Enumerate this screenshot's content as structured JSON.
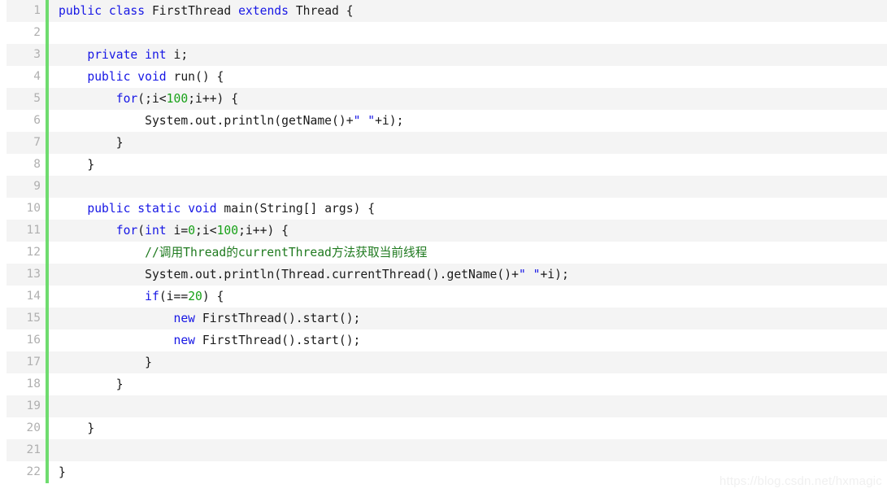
{
  "editor": {
    "language": "java",
    "colors": {
      "background": "#ffffff",
      "stripe": "#f4f4f4",
      "gutter_bar": "#6fdc6f",
      "line_number": "#b0b0b0",
      "keyword": "#1717e5",
      "string": "#1717e5",
      "number": "#17a117",
      "comment": "#1f7a1f",
      "plain_text": "#1a1a1a",
      "watermark": "#f0f0f0"
    },
    "line_count": 22,
    "first_line_number": 1,
    "lines": [
      {
        "number": "1",
        "stripe": true,
        "tokens": [
          {
            "t": "public",
            "c": "kw"
          },
          {
            "t": " ",
            "c": "plain"
          },
          {
            "t": "class",
            "c": "kw"
          },
          {
            "t": " FirstThread ",
            "c": "plain"
          },
          {
            "t": "extends",
            "c": "kw"
          },
          {
            "t": " Thread {",
            "c": "plain"
          }
        ]
      },
      {
        "number": "2",
        "stripe": false,
        "tokens": []
      },
      {
        "number": "3",
        "stripe": true,
        "tokens": [
          {
            "t": "    ",
            "c": "plain"
          },
          {
            "t": "private",
            "c": "kw"
          },
          {
            "t": " ",
            "c": "plain"
          },
          {
            "t": "int",
            "c": "kw"
          },
          {
            "t": " i;",
            "c": "plain"
          }
        ]
      },
      {
        "number": "4",
        "stripe": false,
        "tokens": [
          {
            "t": "    ",
            "c": "plain"
          },
          {
            "t": "public",
            "c": "kw"
          },
          {
            "t": " ",
            "c": "plain"
          },
          {
            "t": "void",
            "c": "kw"
          },
          {
            "t": " run() {",
            "c": "plain"
          }
        ]
      },
      {
        "number": "5",
        "stripe": true,
        "tokens": [
          {
            "t": "        ",
            "c": "plain"
          },
          {
            "t": "for",
            "c": "kw"
          },
          {
            "t": "(;i<",
            "c": "plain"
          },
          {
            "t": "100",
            "c": "num"
          },
          {
            "t": ";i++) {",
            "c": "plain"
          }
        ]
      },
      {
        "number": "6",
        "stripe": false,
        "tokens": [
          {
            "t": "            System.out.println(getName()+",
            "c": "plain"
          },
          {
            "t": "\" \"",
            "c": "str"
          },
          {
            "t": "+i);",
            "c": "plain"
          }
        ]
      },
      {
        "number": "7",
        "stripe": true,
        "tokens": [
          {
            "t": "        }",
            "c": "plain"
          }
        ]
      },
      {
        "number": "8",
        "stripe": false,
        "tokens": [
          {
            "t": "    }",
            "c": "plain"
          }
        ]
      },
      {
        "number": "9",
        "stripe": true,
        "tokens": []
      },
      {
        "number": "10",
        "stripe": false,
        "tokens": [
          {
            "t": "    ",
            "c": "plain"
          },
          {
            "t": "public",
            "c": "kw"
          },
          {
            "t": " ",
            "c": "plain"
          },
          {
            "t": "static",
            "c": "kw"
          },
          {
            "t": " ",
            "c": "plain"
          },
          {
            "t": "void",
            "c": "kw"
          },
          {
            "t": " main(String[] args) {",
            "c": "plain"
          }
        ]
      },
      {
        "number": "11",
        "stripe": true,
        "tokens": [
          {
            "t": "        ",
            "c": "plain"
          },
          {
            "t": "for",
            "c": "kw"
          },
          {
            "t": "(",
            "c": "plain"
          },
          {
            "t": "int",
            "c": "kw"
          },
          {
            "t": " i=",
            "c": "plain"
          },
          {
            "t": "0",
            "c": "num"
          },
          {
            "t": ";i<",
            "c": "plain"
          },
          {
            "t": "100",
            "c": "num"
          },
          {
            "t": ";i++) {",
            "c": "plain"
          }
        ]
      },
      {
        "number": "12",
        "stripe": false,
        "tokens": [
          {
            "t": "            ",
            "c": "plain"
          },
          {
            "t": "//调用Thread的currentThread方法获取当前线程",
            "c": "cmt"
          }
        ]
      },
      {
        "number": "13",
        "stripe": true,
        "tokens": [
          {
            "t": "            System.out.println(Thread.currentThread().getName()+",
            "c": "plain"
          },
          {
            "t": "\" \"",
            "c": "str"
          },
          {
            "t": "+i);",
            "c": "plain"
          }
        ]
      },
      {
        "number": "14",
        "stripe": false,
        "tokens": [
          {
            "t": "            ",
            "c": "plain"
          },
          {
            "t": "if",
            "c": "kw"
          },
          {
            "t": "(i==",
            "c": "plain"
          },
          {
            "t": "20",
            "c": "num"
          },
          {
            "t": ") {",
            "c": "plain"
          }
        ]
      },
      {
        "number": "15",
        "stripe": true,
        "tokens": [
          {
            "t": "                ",
            "c": "plain"
          },
          {
            "t": "new",
            "c": "kw"
          },
          {
            "t": " FirstThread().start();",
            "c": "plain"
          }
        ]
      },
      {
        "number": "16",
        "stripe": false,
        "tokens": [
          {
            "t": "                ",
            "c": "plain"
          },
          {
            "t": "new",
            "c": "kw"
          },
          {
            "t": " FirstThread().start();",
            "c": "plain"
          }
        ]
      },
      {
        "number": "17",
        "stripe": true,
        "tokens": [
          {
            "t": "            }",
            "c": "plain"
          }
        ]
      },
      {
        "number": "18",
        "stripe": false,
        "tokens": [
          {
            "t": "        }",
            "c": "plain"
          }
        ]
      },
      {
        "number": "19",
        "stripe": true,
        "tokens": []
      },
      {
        "number": "20",
        "stripe": false,
        "tokens": [
          {
            "t": "    }",
            "c": "plain"
          }
        ]
      },
      {
        "number": "21",
        "stripe": true,
        "tokens": []
      },
      {
        "number": "22",
        "stripe": false,
        "tokens": [
          {
            "t": "}",
            "c": "plain"
          }
        ]
      }
    ]
  },
  "watermark": {
    "text": "https://blog.csdn.net/hxmagic"
  }
}
